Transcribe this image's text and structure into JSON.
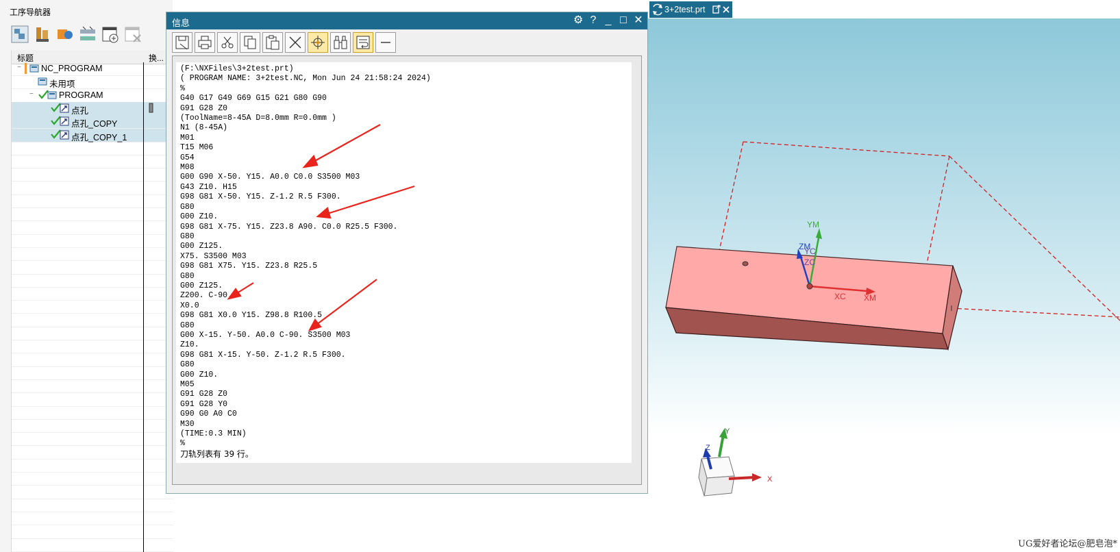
{
  "navigator": {
    "title": "工序导航器",
    "toolbar_icons": [
      "program-order-view-icon",
      "machine-tool-view-icon",
      "geometry-view-icon",
      "method-view-icon",
      "create-operation-icon",
      "delete-icon"
    ],
    "columns": {
      "title": "标题",
      "swap": "换..."
    },
    "tree": [
      {
        "label": "NC_PROGRAM",
        "indent": 0,
        "expander": "−",
        "icon": "program-folder-icon",
        "check": false,
        "selected": false
      },
      {
        "label": "未用项",
        "indent": 1,
        "expander": "",
        "icon": "program-folder-icon",
        "check": false,
        "selected": false
      },
      {
        "label": "PROGRAM",
        "indent": 1,
        "expander": "−",
        "icon": "program-folder-icon",
        "check": true,
        "selected": false
      },
      {
        "label": "点孔",
        "indent": 2,
        "expander": "",
        "icon": "drill-operation-icon",
        "check": true,
        "selected": true
      },
      {
        "label": "点孔_COPY",
        "indent": 2,
        "expander": "",
        "icon": "drill-operation-icon",
        "check": true,
        "selected": true
      },
      {
        "label": "点孔_COPY_1",
        "indent": 2,
        "expander": "",
        "icon": "drill-operation-icon",
        "check": true,
        "selected": true
      }
    ]
  },
  "info_window": {
    "title": "信息",
    "controls": {
      "settings": "⚙",
      "help": "?",
      "minimize": "_",
      "maximize": "□",
      "close": "✕"
    },
    "toolbar_icons": [
      "save-icon",
      "print-icon",
      "cut-icon",
      "copy-icon",
      "paste-icon",
      "clear-icon",
      "locate-icon",
      "find-icon",
      "word-wrap-icon",
      "collapse-icon"
    ],
    "lines": [
      "(F:\\NXFiles\\3+2test.prt)",
      "( PROGRAM NAME: 3+2test.NC, Mon Jun 24 21:58:24 2024)",
      "%",
      "G40 G17 G49 G69 G15 G21 G80 G90",
      "G91 G28 Z0",
      "(ToolName=8-45A D=8.0mm R=0.0mm )",
      "N1 (8-45A)",
      "M01",
      "T15 M06",
      "G54",
      "M08",
      "G00 G90 X-50. Y15. A0.0 C0.0 S3500 M03",
      "G43 Z10. H15",
      "G98 G81 X-50. Y15. Z-1.2 R.5 F300.",
      "G80",
      "G00 Z10.",
      "G98 G81 X-75. Y15. Z23.8 A90. C0.0 R25.5 F300.",
      "G80",
      "G00 Z125.",
      "X75. S3500 M03",
      "G98 G81 X75. Y15. Z23.8 R25.5",
      "G80",
      "G00 Z125.",
      "Z200. C-90.",
      "X0.0",
      "G98 G81 X0.0 Y15. Z98.8 R100.5",
      "G80",
      "G00 X-15. Y-50. A0.0 C-90. S3500 M03",
      "Z10.",
      "G98 G81 X-15. Y-50. Z-1.2 R.5 F300.",
      "G80",
      "G00 Z10.",
      "M05",
      "G91 G28 Z0",
      "G91 G28 Y0",
      "G90 G0 A0 C0",
      "M30",
      "(TIME:0.3 MIN)",
      "%",
      "刀轨列表有 39 行。"
    ]
  },
  "viewport": {
    "tab_label": "3+2test.prt",
    "axis_labels": {
      "ym": "YM",
      "zm": "ZM",
      "yc": "YC",
      "zc": "ZC",
      "xc": "XC",
      "xm": "XM"
    },
    "triad_labels": {
      "x": "X",
      "y": "Y",
      "z": "Z"
    },
    "watermark": "UG爱好者论坛@肥皂泡*",
    "colors": {
      "part_top": "#ffaaaa",
      "part_front": "#a0534f",
      "csys_x": "#e03030",
      "csys_y": "#3aaa3a",
      "csys_z": "#2040c0",
      "dashed": "#d02020"
    }
  }
}
